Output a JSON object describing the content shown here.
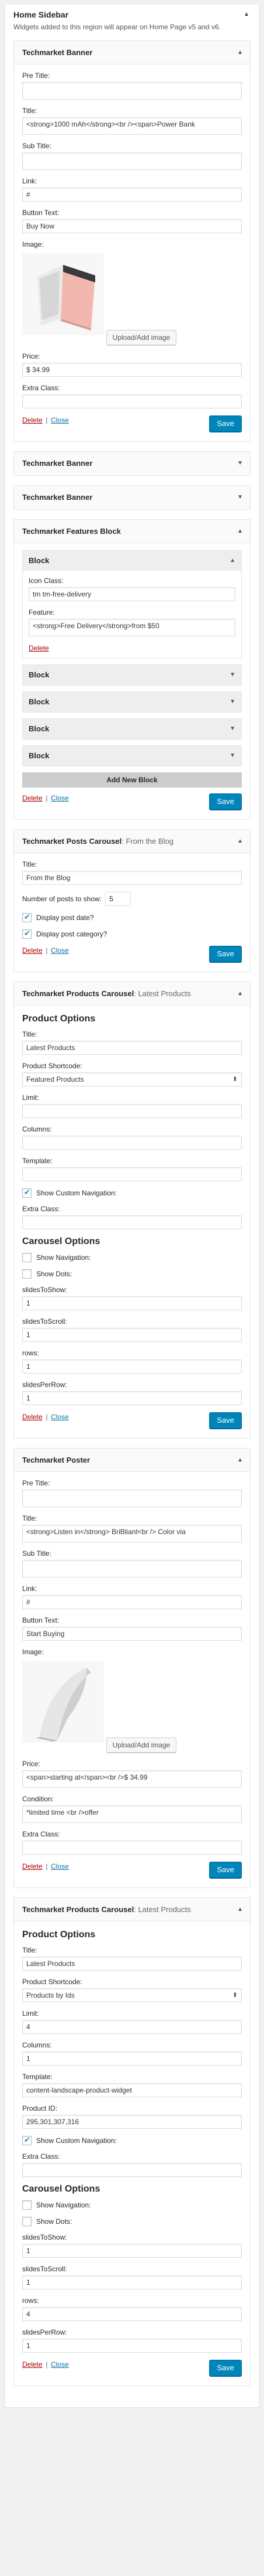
{
  "sidebar": {
    "title": "Home Sidebar",
    "description": "Widgets added to this region will appear on Home Page v5 and v6."
  },
  "common": {
    "delete_label": "Delete",
    "close_label": "Close",
    "save_label": "Save",
    "separator": "|",
    "upload_label": "Upload/Add image"
  },
  "banner1": {
    "title": "Techmarket Banner",
    "pre_title_label": "Pre Title:",
    "pre_title_value": "",
    "title_label": "Title:",
    "title_value": "<strong>1000 mAh</strong><br /><span>Power Bank",
    "sub_title_label": "Sub Title:",
    "sub_title_value": "",
    "link_label": "Link:",
    "link_value": "#",
    "button_text_label": "Button Text:",
    "button_text_value": "Buy Now",
    "image_label": "Image:",
    "price_label": "Price:",
    "price_value": "$ 34.99",
    "extra_class_label": "Extra Class:",
    "extra_class_value": ""
  },
  "collapsed": {
    "banner2_title": "Techmarket Banner",
    "banner3_title": "Techmarket Banner"
  },
  "features": {
    "title": "Techmarket Features Block",
    "block_label": "Block",
    "icon_class_label": "Icon Class:",
    "icon_class_value": "tm tm-free-delivery",
    "feature_label": "Feature:",
    "feature_value": "<strong>Free Delivery</strong>from $50",
    "block2_label": "Block",
    "block3_label": "Block",
    "block4_label": "Block",
    "block5_label": "Block",
    "add_block_label": "Add New Block"
  },
  "posts": {
    "title": "Techmarket Posts Carousel",
    "subtitle": ": From the Blog",
    "title_label": "Title:",
    "title_value": "From the Blog",
    "number_label": "Number of posts to show:",
    "number_value": "5",
    "display_date_label": "Display post date?",
    "display_category_label": "Display post category?"
  },
  "products1": {
    "title": "Techmarket Products Carousel",
    "subtitle": ": Latest Products",
    "product_options_heading": "Product Options",
    "title_label": "Title:",
    "title_value": "Latest Products",
    "shortcode_label": "Product Shortcode:",
    "shortcode_value": "Featured Products",
    "limit_label": "Limit:",
    "limit_value": "",
    "columns_label": "Columns:",
    "columns_value": "",
    "template_label": "Template:",
    "template_value": "",
    "custom_nav_label": "Show Custom Navigation:",
    "extra_class_label": "Extra Class:",
    "extra_class_value": "",
    "carousel_heading": "Carousel Options",
    "show_nav_label": "Show Navigation:",
    "show_dots_label": "Show Dots:",
    "slides_to_show_label": "slidesToShow:",
    "slides_to_show_value": "1",
    "slides_to_scroll_label": "slidesToScroll:",
    "slides_to_scroll_value": "1",
    "rows_label": "rows:",
    "rows_value": "1",
    "slides_per_row_label": "slidesPerRow:",
    "slides_per_row_value": "1"
  },
  "poster": {
    "title": "Techmarket Poster",
    "pre_title_label": "Pre Title:",
    "pre_title_value": "",
    "title_label": "Title:",
    "title_value": "<strong>Listen in</strong> BriBliant<br /> Color via",
    "sub_title_label": "Sub Title:",
    "sub_title_value": "",
    "link_label": "Link:",
    "link_value": "#",
    "button_text_label": "Button Text:",
    "button_text_value": "Start Buying",
    "image_label": "Image:",
    "price_label": "Price:",
    "price_value": "<span>starting at</span><br />$ 34.99",
    "condition_label": "Condition:",
    "condition_value": "*limited time <br />offer",
    "extra_class_label": "Extra Class:",
    "extra_class_value": ""
  },
  "products2": {
    "title": "Techmarket Products Carousel",
    "subtitle": ": Latest Products",
    "product_options_heading": "Product Options",
    "title_label": "Title:",
    "title_value": "Latest Products",
    "shortcode_label": "Product Shortcode:",
    "shortcode_value": "Products by Ids",
    "limit_label": "Limit:",
    "limit_value": "4",
    "columns_label": "Columns:",
    "columns_value": "1",
    "template_label": "Template:",
    "template_value": "content-landscape-product-widget",
    "product_id_label": "Product ID:",
    "product_id_value": "295,301,307,316",
    "custom_nav_label": "Show Custom Navigation:",
    "extra_class_label": "Extra Class:",
    "extra_class_value": "",
    "carousel_heading": "Carousel Options",
    "show_nav_label": "Show Navigation:",
    "show_dots_label": "Show Dots:",
    "slides_to_show_label": "slidesToShow:",
    "slides_to_show_value": "1",
    "slides_to_scroll_label": "slidesToScroll:",
    "slides_to_scroll_value": "1",
    "rows_label": "rows:",
    "rows_value": "4",
    "slides_per_row_label": "slidesPerRow:",
    "slides_per_row_value": "1"
  },
  "colors": {
    "accent": "#0085ba",
    "delete": "#a00000",
    "link": "#0073aa"
  }
}
